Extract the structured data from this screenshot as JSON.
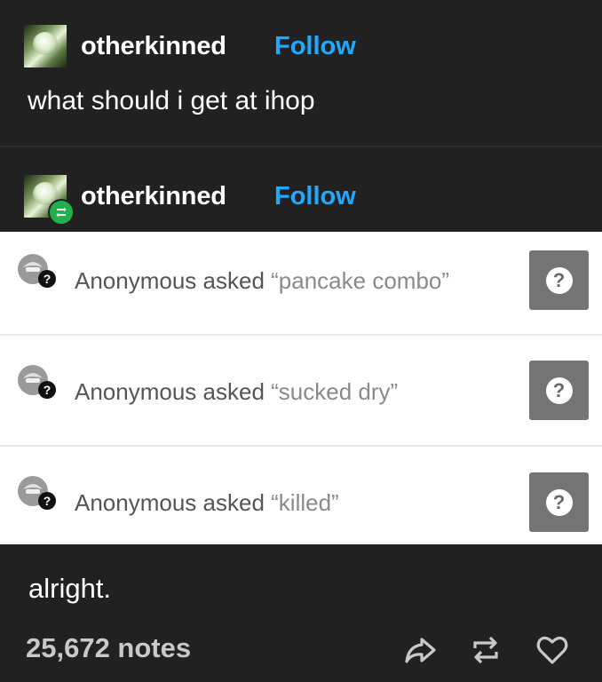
{
  "original_post": {
    "username": "otherkinned",
    "follow_label": "Follow",
    "text": "what should i get at ihop"
  },
  "reblog": {
    "username": "otherkinned",
    "follow_label": "Follow"
  },
  "asks": [
    {
      "prefix": "Anonymous asked ",
      "question": "“pancake combo”",
      "button_glyph": "?"
    },
    {
      "prefix": "Anonymous asked ",
      "question": "“sucked dry”",
      "button_glyph": "?"
    },
    {
      "prefix": "Anonymous asked ",
      "question": "“killed”",
      "button_glyph": "?"
    }
  ],
  "reply_text": "alright.",
  "footer": {
    "notes": "25,672 notes",
    "actions": [
      "share-icon",
      "reblog-icon",
      "like-icon"
    ]
  },
  "colors": {
    "background": "#212121",
    "follow": "#1fa9ff",
    "reblog_badge": "#21b04b",
    "ask_button": "#747474"
  }
}
